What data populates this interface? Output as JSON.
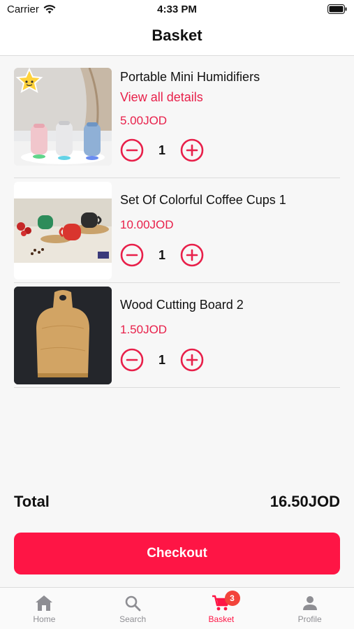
{
  "status_bar": {
    "carrier": "Carrier",
    "time": "4:33 PM"
  },
  "header": {
    "title": "Basket"
  },
  "items": [
    {
      "name": "Portable Mini Humidifiers",
      "details_link": "View all details",
      "price": "5.00JOD",
      "quantity": "1"
    },
    {
      "name": "Set Of Colorful Coffee Cups 1",
      "price": "10.00JOD",
      "quantity": "1"
    },
    {
      "name": "Wood Cutting Board 2",
      "price": "1.50JOD",
      "quantity": "1"
    }
  ],
  "summary": {
    "total_label": "Total",
    "total_value": "16.50JOD"
  },
  "checkout": {
    "label": "Checkout"
  },
  "tab_bar": {
    "tabs": [
      {
        "label": "Home",
        "icon": "home-icon"
      },
      {
        "label": "Search",
        "icon": "search-icon"
      },
      {
        "label": "Basket",
        "icon": "cart-icon",
        "badge": "3"
      },
      {
        "label": "Profile",
        "icon": "profile-icon"
      }
    ],
    "active": "Basket"
  },
  "colors": {
    "accent": "#fe1545",
    "price": "#e8204a",
    "badge": "#f2443b"
  }
}
